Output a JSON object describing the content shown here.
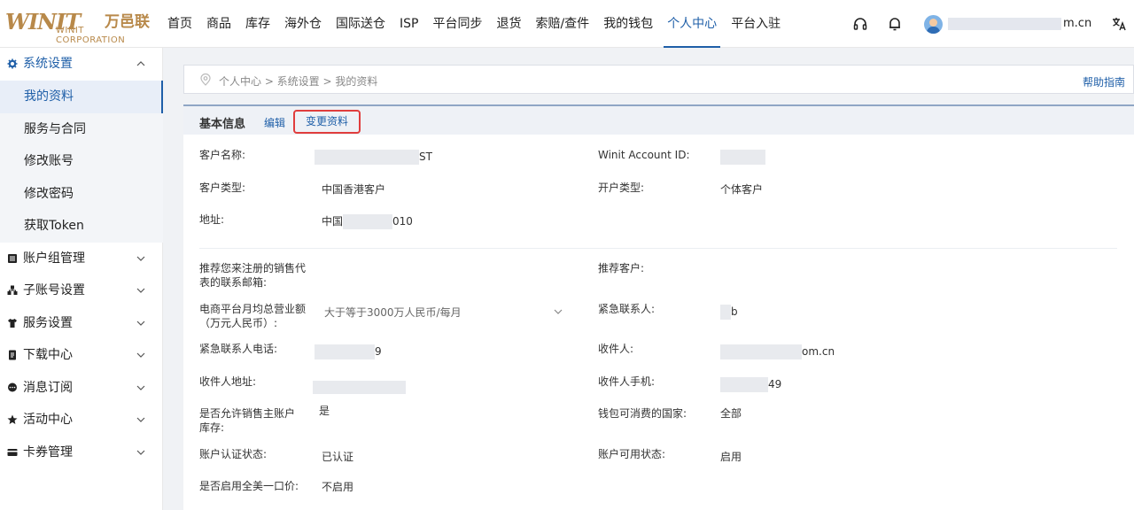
{
  "header": {
    "logo_mark": "WINIT",
    "logo_cn": "万邑联",
    "logo_en": "WINIT CORPORATION",
    "nav": [
      "首页",
      "商品",
      "库存",
      "海外仓",
      "国际送仓",
      "ISP",
      "平台同步",
      "退货",
      "索赔/查件",
      "我的钱包",
      "个人中心",
      "平台入驻"
    ],
    "active_nav": "个人中心",
    "user_suffix": "m.cn",
    "icons": [
      "headset-icon",
      "bell-icon",
      "translate-icon"
    ]
  },
  "sidebar": {
    "groups": [
      {
        "label": "系统设置",
        "icon": "gear-icon",
        "open": true,
        "items": [
          "我的资料",
          "服务与合同",
          "修改账号",
          "修改密码",
          "获取Token"
        ],
        "active_item": "我的资料"
      },
      {
        "label": "账户组管理",
        "icon": "list-icon"
      },
      {
        "label": "子账号设置",
        "icon": "org-icon"
      },
      {
        "label": "服务设置",
        "icon": "shirt-icon"
      },
      {
        "label": "下载中心",
        "icon": "file-icon"
      },
      {
        "label": "消息订阅",
        "icon": "chat-icon"
      },
      {
        "label": "活动中心",
        "icon": "star-icon"
      },
      {
        "label": "卡券管理",
        "icon": "card-icon"
      }
    ]
  },
  "breadcrumb": "个人中心 > 系统设置 > 我的资料",
  "help_link": "帮助指南",
  "card": {
    "title": "基本信息",
    "edit": "编辑",
    "change": "变更资料"
  },
  "fields": {
    "customer_name_label": "客户名称:",
    "customer_name_suffix": "ST",
    "account_id_label": "Winit Account ID:",
    "customer_type_label": "客户类型:",
    "customer_type_value": "中国香港客户",
    "open_type_label": "开户类型:",
    "open_type_value": "个体客户",
    "address_label": "地址:",
    "address_prefix": "中国",
    "address_suffix": "010",
    "referrer_email_label": "推荐您来注册的销售代表的联系邮箱:",
    "referrer_customer_label": "推荐客户:",
    "revenue_label": "电商平台月均总营业额（万元人民币）:",
    "revenue_value": "大于等于3000万人民币/每月",
    "emergency_contact_label": "紧急联系人:",
    "emergency_contact_suffix": "b",
    "emergency_phone_label": "紧急联系人电话:",
    "emergency_phone_suffix": "9",
    "receiver_label": "收件人:",
    "receiver_suffix": "om.cn",
    "receiver_address_label": "收件人地址:",
    "receiver_mobile_label": "收件人手机:",
    "receiver_mobile_suffix": "49",
    "allow_sales_label": "是否允许销售主账户库存:",
    "allow_sales_value": "是",
    "wallet_country_label": "钱包可消费的国家:",
    "wallet_country_value": "全部",
    "auth_status_label": "账户认证状态:",
    "auth_status_value": "已认证",
    "available_status_label": "账户可用状态:",
    "available_status_value": "启用",
    "one_price_label": "是否启用全美一口价:",
    "one_price_value": "不启用"
  }
}
